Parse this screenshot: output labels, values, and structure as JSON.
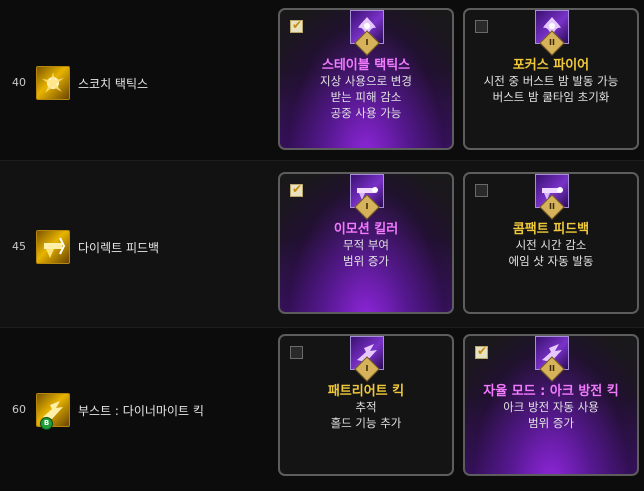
{
  "rows": [
    {
      "level": "40",
      "skill_name": "스코치 택틱스",
      "left_card": {
        "selected": true,
        "icon": "flame-burst-icon",
        "tier": "I",
        "title": "스테이블 택틱스",
        "lines": [
          "지상 사용으로 변경",
          "받는 피해 감소",
          "공중 사용 가능"
        ]
      },
      "right_card": {
        "selected": false,
        "icon": "flame-burst-icon",
        "tier": "II",
        "title": "포커스 파이어",
        "lines": [
          "시전 중 버스트 밤 발동 가능",
          "버스트 밤 쿨타임 초기화"
        ]
      }
    },
    {
      "level": "45",
      "skill_name": "다이렉트 피드백",
      "left_card": {
        "selected": true,
        "icon": "gun-blast-icon",
        "tier": "I",
        "title": "이모션 킬러",
        "lines": [
          "무적 부여",
          "범위 증가"
        ]
      },
      "right_card": {
        "selected": false,
        "icon": "gun-blast-icon",
        "tier": "II",
        "title": "콤팩트 피드백",
        "lines": [
          "시전 시간 감소",
          "에임 샷 자동 발동"
        ]
      }
    },
    {
      "level": "60",
      "skill_name": "부스트 : 다이너마이트 킥",
      "skill_badge": "B",
      "left_card": {
        "selected": false,
        "icon": "kick-blast-icon",
        "tier": "I",
        "title": "패트리어트 킥",
        "lines": [
          "추적",
          "홀드 기능 추가"
        ]
      },
      "right_card": {
        "selected": true,
        "icon": "kick-blast-icon",
        "tier": "II",
        "title": "자율 모드 : 아크 방전 킥",
        "lines": [
          "아크 방전 자동 사용",
          "범위 증가"
        ]
      }
    }
  ],
  "colors": {
    "title_gold": "#f0c93a",
    "title_selected": "#f27aff",
    "card_border": "#5d5d5d",
    "selected_glow": "#9628e6"
  },
  "check_mark": "✔"
}
